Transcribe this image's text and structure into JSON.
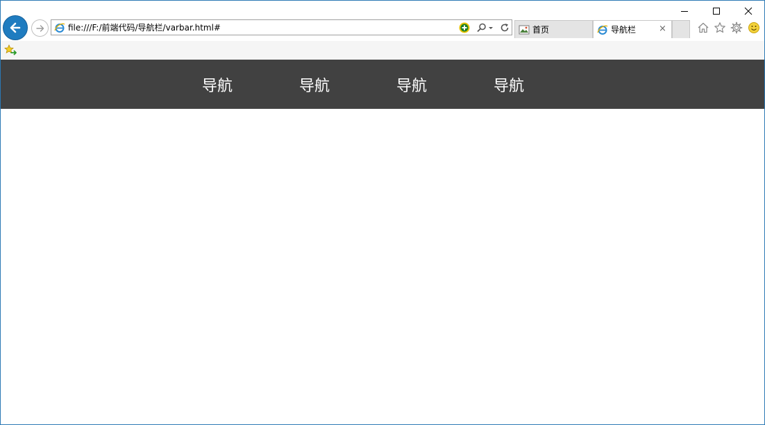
{
  "browser": {
    "address": "file:///F:/前端代码/导航栏/varbar.html#",
    "tabs": [
      {
        "label": "首页",
        "active": false
      },
      {
        "label": "导航栏",
        "active": true
      }
    ],
    "tab_close_glyph": "×",
    "icons": {
      "back": "back-arrow-icon",
      "forward": "forward-arrow-icon",
      "page": "ie-page-icon",
      "addon": "addon-plus-icon",
      "search": "search-icon",
      "refresh": "refresh-icon",
      "home": "home-icon",
      "favorites": "star-icon",
      "tools": "gear-icon",
      "feedback": "smiley-icon",
      "add_favorite": "add-favorite-icon"
    },
    "colors": {
      "accent": "#1f7cc0",
      "frame": "#2b79b4"
    }
  },
  "page": {
    "navbar": {
      "background": "#414141",
      "items": [
        {
          "label": "导航"
        },
        {
          "label": "导航"
        },
        {
          "label": "导航"
        },
        {
          "label": "导航"
        }
      ]
    }
  }
}
